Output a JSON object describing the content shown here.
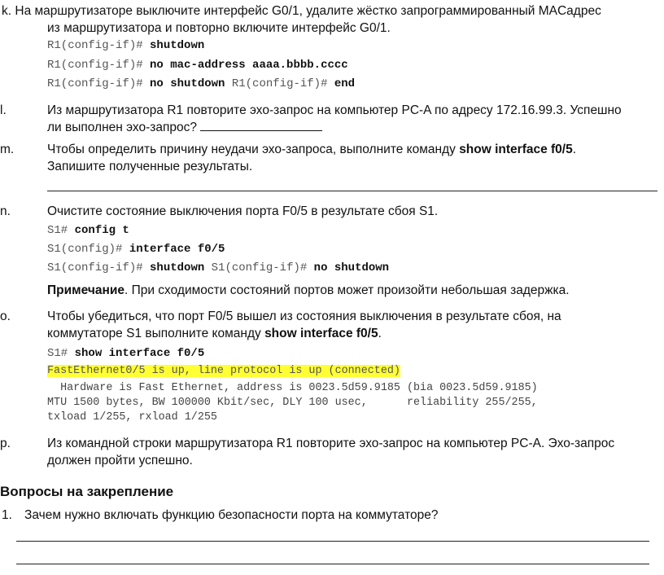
{
  "steps": {
    "k": {
      "marker": "k.",
      "line1": "На маршрутизаторе выключите интерфейс G0/1, удалите жёстко запрограммированный MACадрес",
      "line2": "из маршрутизатора и повторно включите интерфейс G0/1.",
      "commands": [
        {
          "prompt": "R1(config-if)# ",
          "cmd": "shutdown",
          "prompt2": "",
          "cmd2": ""
        },
        {
          "prompt": "R1(config-if)# ",
          "cmd": "no mac-address aaaa.bbbb.cccc",
          "prompt2": "",
          "cmd2": ""
        },
        {
          "prompt": "R1(config-if)# ",
          "cmd": "no shutdown",
          "prompt2": " R1(config-if)# ",
          "cmd2": "end"
        }
      ]
    },
    "l": {
      "marker": "l.",
      "line1": "Из маршрутизатора R1 повторите эхо-запрос на компьютер PC-A по адресу 172.16.99.3. Успешно",
      "line2": "ли выполнен эхо-запрос?"
    },
    "m": {
      "marker": "m.",
      "line1_pre": "Чтобы определить причину неудачи эхо-запроса, выполните команду ",
      "line1_bold": "show interface f0/5",
      "line1_post": ".",
      "line2": "Запишите полученные результаты."
    },
    "n": {
      "marker": "n.",
      "line1": "Очистите состояние выключения порта F0/5 в результате сбоя S1.",
      "commands": [
        {
          "prompt": "S1# ",
          "cmd": "config t",
          "prompt2": "",
          "cmd2": ""
        },
        {
          "prompt": "S1(config)# ",
          "cmd": "interface f0/5",
          "prompt2": "",
          "cmd2": ""
        },
        {
          "prompt": "S1(config-if)# ",
          "cmd": "shutdown",
          "prompt2": " S1(config-if)# ",
          "cmd2": "no shutdown"
        }
      ],
      "note_bold": "Примечание",
      "note_text": ". При сходимости состояний портов может произойти небольшая задержка."
    },
    "o": {
      "marker": "o.",
      "line1": "Чтобы убедиться, что порт F0/5 вышел из состояния выключения в результате сбоя, на",
      "line2_pre": "коммутаторе S1 выполните команду ",
      "line2_bold": "show interface f0/5",
      "line2_post": ".",
      "command": {
        "prompt": "S1# ",
        "cmd": "show interface f0/5"
      },
      "output_highlight": "FastEthernet0/5 is up, line protocol is up (connected)",
      "output_lines": [
        "  Hardware is Fast Ethernet, address is 0023.5d59.9185 (bia 0023.5d59.9185)",
        "MTU 1500 bytes, BW 100000 Kbit/sec, DLY 100 usec,      reliability 255/255,",
        "txload 1/255, rxload 1/255"
      ]
    },
    "p": {
      "marker": "p.",
      "line1": "Из командной строки маршрутизатора R1 повторите эхо-запрос на компьютер PC-A. Эхо-запрос",
      "line2": "должен пройти успешно."
    }
  },
  "review": {
    "heading": "Вопросы на закрепление",
    "questions": [
      {
        "marker": "1.",
        "text": "Зачем нужно включать функцию безопасности порта на коммутаторе?"
      }
    ]
  }
}
